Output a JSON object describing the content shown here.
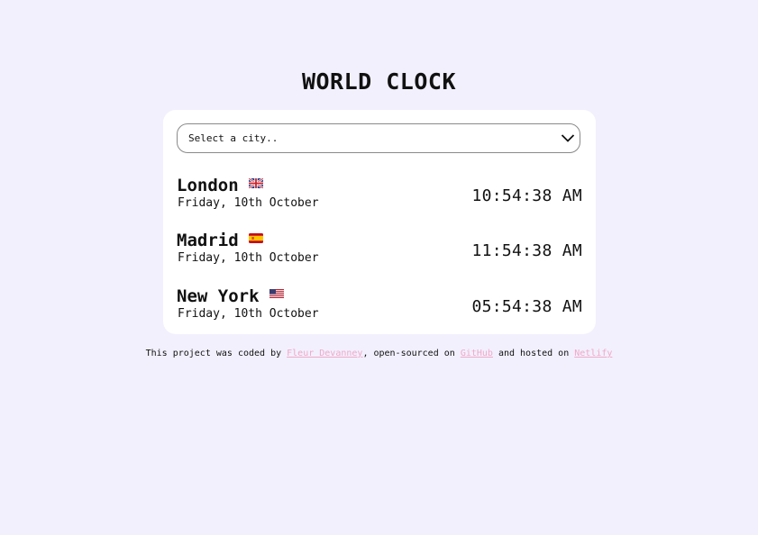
{
  "title": "WORLD CLOCK",
  "select": {
    "placeholder": "Select a city.."
  },
  "cities": [
    {
      "name": "London",
      "flag": "uk-flag-icon",
      "date": "Friday, 10th October",
      "time": "10:54:38 AM"
    },
    {
      "name": "Madrid",
      "flag": "spain-flag-icon",
      "date": "Friday, 10th October",
      "time": "11:54:38 AM"
    },
    {
      "name": "New York",
      "flag": "usa-flag-icon",
      "date": "Friday, 10th October",
      "time": "05:54:38 AM"
    }
  ],
  "footer": {
    "text_1": "This project was coded by ",
    "author_link": "Fleur Devanney",
    "text_2": ", open-sourced on ",
    "github_link": "GitHub",
    "text_3": " and hosted on ",
    "netlify_link": "Netlify"
  },
  "colors": {
    "background": "#f2f0fd",
    "card": "#ffffff",
    "link": "#f0a8c8"
  }
}
